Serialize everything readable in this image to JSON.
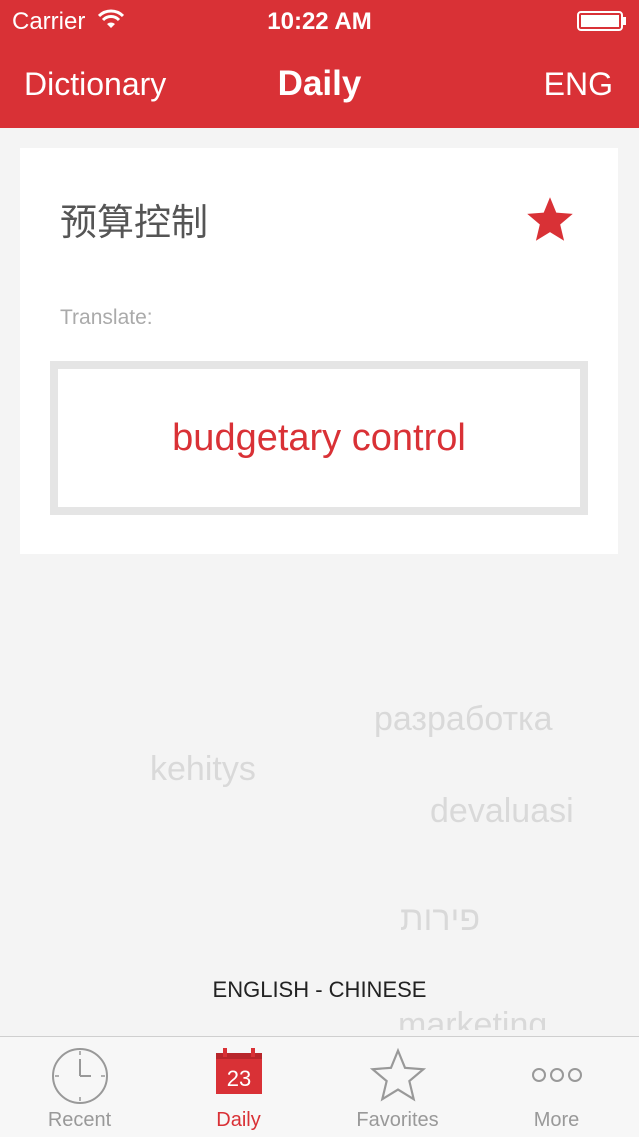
{
  "status_bar": {
    "carrier": "Carrier",
    "time": "10:22 AM"
  },
  "nav": {
    "left": "Dictionary",
    "title": "Daily",
    "right": "ENG"
  },
  "card": {
    "term": "预算控制",
    "translate_label": "Translate:",
    "translation": "budgetary control",
    "favorite": true
  },
  "background_words": [
    "разработка",
    "kehitys",
    "devaluasi",
    "פירות",
    "marketing"
  ],
  "language_pair": "ENGLISH - CHINESE",
  "tabs": [
    {
      "label": "Recent",
      "icon": "clock-icon",
      "active": false
    },
    {
      "label": "Daily",
      "icon": "calendar-icon",
      "badge": "23",
      "active": true
    },
    {
      "label": "Favorites",
      "icon": "star-outline-icon",
      "active": false
    },
    {
      "label": "More",
      "icon": "more-dots-icon",
      "active": false
    }
  ],
  "colors": {
    "accent": "#d93136",
    "background": "#f4f4f4",
    "tab_inactive": "#999999"
  }
}
